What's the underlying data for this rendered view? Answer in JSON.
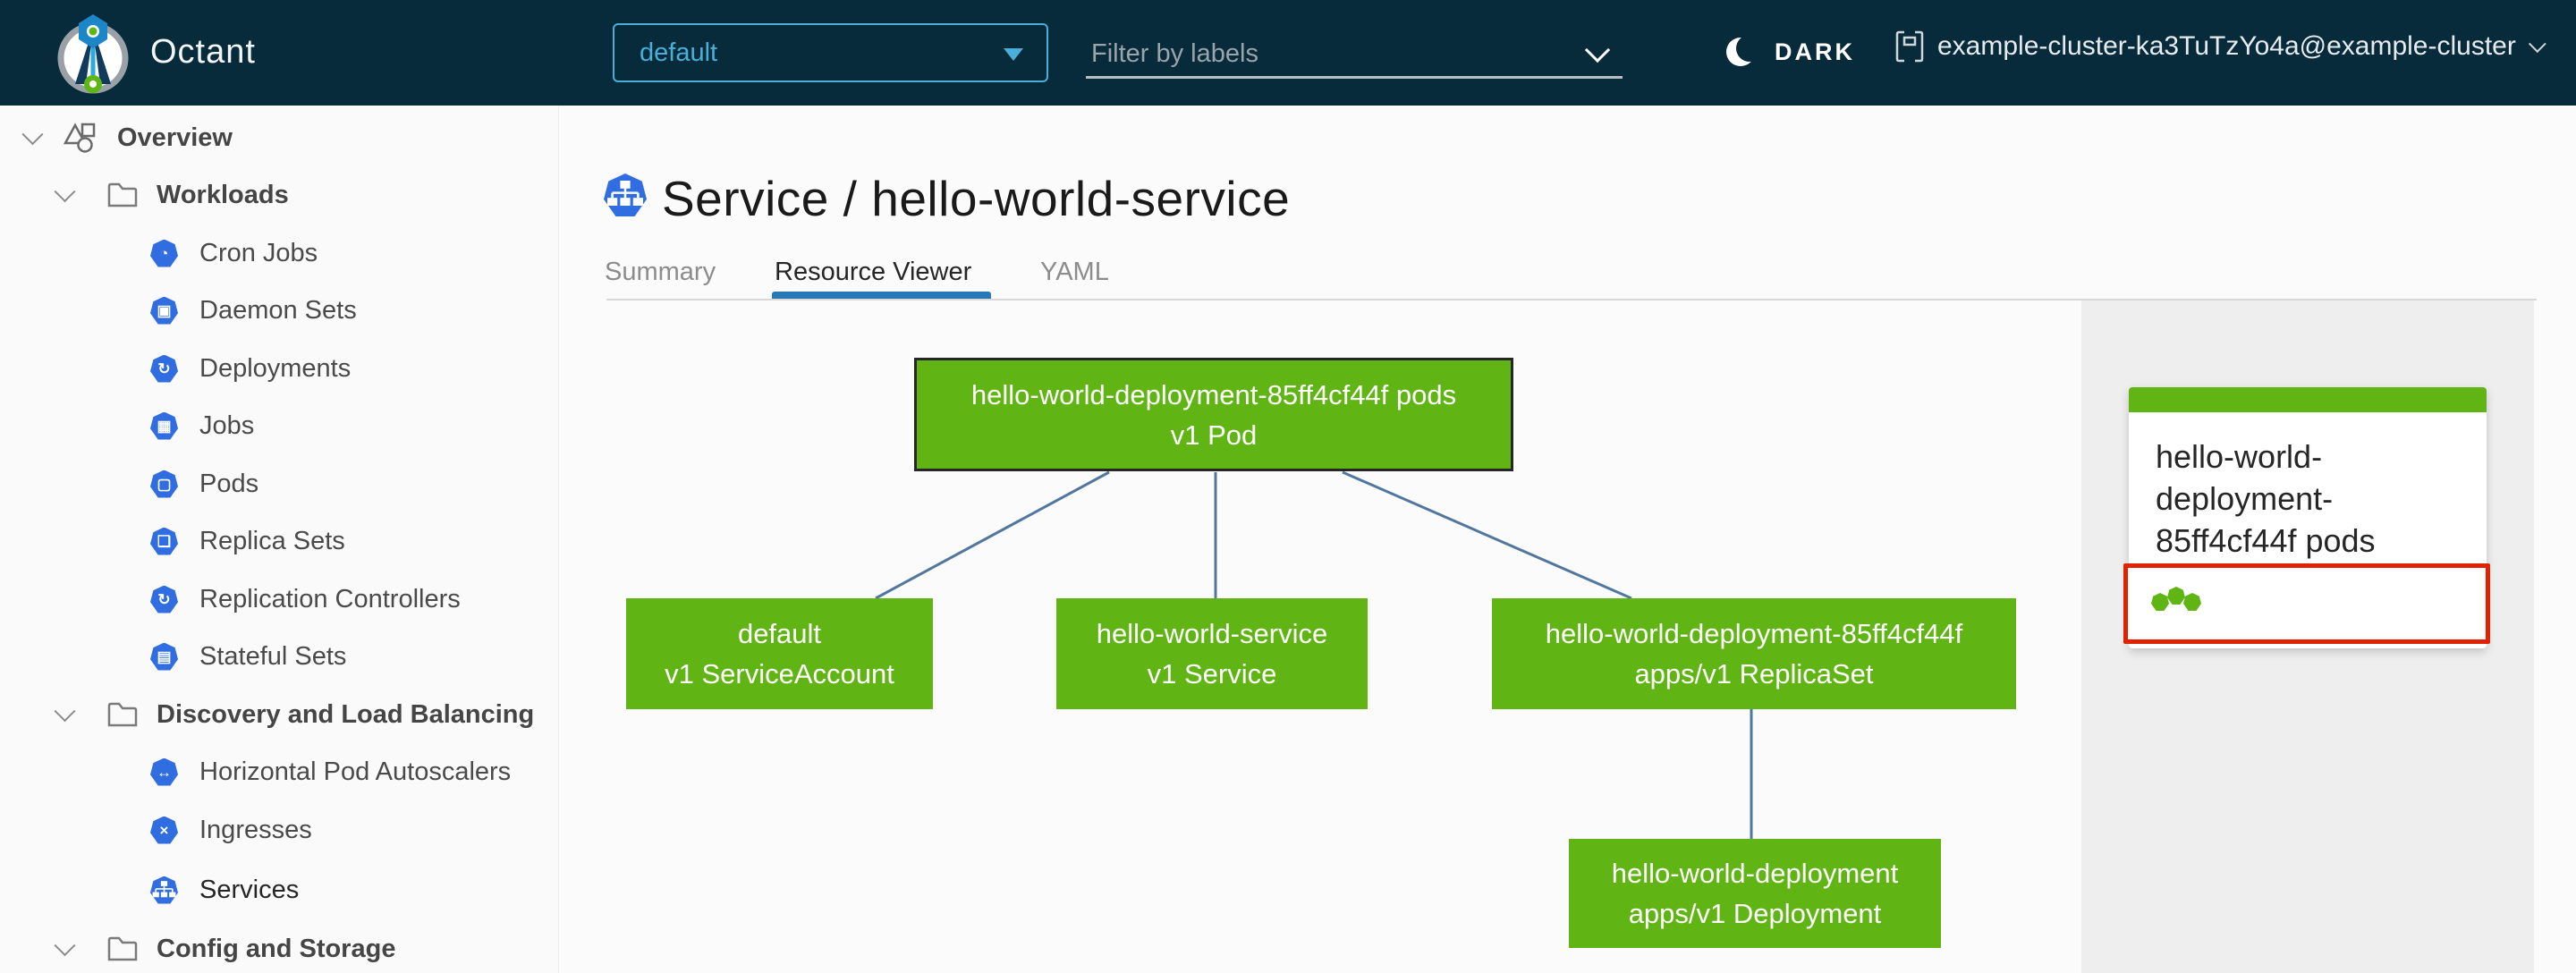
{
  "colors": {
    "header_bg": "#082b3c",
    "accent_blue": "#49afd9",
    "k8s_icon_blue": "#2f6de0",
    "node_green": "#60b515",
    "edge_blue": "#51779f",
    "tab_active_blue": "#2778b5",
    "selected_row_bg": "#d8e1e7",
    "alert_red": "#e12200",
    "panel_bg": "#eeeeee"
  },
  "header": {
    "app_title": "Octant",
    "namespace_select": {
      "value": "default"
    },
    "label_filter": {
      "placeholder": "Filter by labels"
    },
    "theme_toggle_label": "DARK",
    "context_selector_label": "example-cluster-ka3TuTzYo4a@example-cluster"
  },
  "sidebar": {
    "items": [
      {
        "label": "Overview",
        "level": 0,
        "icon": "objects-icon",
        "expanded": true
      },
      {
        "label": "Workloads",
        "level": 1,
        "icon": "folder-icon",
        "expanded": true
      },
      {
        "label": "Cron Jobs",
        "level": 2,
        "icon": "cronjob-icon",
        "glyph": "◔"
      },
      {
        "label": "Daemon Sets",
        "level": 2,
        "icon": "daemonset-icon",
        "glyph": "▣"
      },
      {
        "label": "Deployments",
        "level": 2,
        "icon": "deployment-icon",
        "glyph": "↻"
      },
      {
        "label": "Jobs",
        "level": 2,
        "icon": "job-icon",
        "glyph": "▦"
      },
      {
        "label": "Pods",
        "level": 2,
        "icon": "pod-icon",
        "glyph": "▢"
      },
      {
        "label": "Replica Sets",
        "level": 2,
        "icon": "replicaset-icon",
        "glyph": "❏"
      },
      {
        "label": "Replication Controllers",
        "level": 2,
        "icon": "replicationcontroller-icon",
        "glyph": "↻"
      },
      {
        "label": "Stateful Sets",
        "level": 2,
        "icon": "statefulset-icon",
        "glyph": "▤"
      },
      {
        "label": "Discovery and Load Balancing",
        "level": 1,
        "icon": "folder-icon",
        "expanded": true
      },
      {
        "label": "Horizontal Pod Autoscalers",
        "level": 2,
        "icon": "hpa-icon",
        "glyph": "↔"
      },
      {
        "label": "Ingresses",
        "level": 2,
        "icon": "ingress-icon",
        "glyph": "×"
      },
      {
        "label": "Services",
        "level": 2,
        "icon": "service-icon",
        "selected": true
      },
      {
        "label": "Config and Storage",
        "level": 1,
        "icon": "folder-icon",
        "expanded": true
      }
    ]
  },
  "main": {
    "page_title": "Service / hello-world-service",
    "tabs": [
      {
        "label": "Summary",
        "active": false
      },
      {
        "label": "Resource Viewer",
        "active": true
      },
      {
        "label": "YAML",
        "active": false
      }
    ]
  },
  "graph": {
    "nodes": [
      {
        "id": "pod",
        "line1": "hello-world-deployment-85ff4cf44f pods",
        "line2": "v1 Pod",
        "selected": true
      },
      {
        "id": "serviceaccount",
        "line1": "default",
        "line2": "v1 ServiceAccount",
        "selected": false
      },
      {
        "id": "service",
        "line1": "hello-world-service",
        "line2": "v1 Service",
        "selected": false
      },
      {
        "id": "replicaset",
        "line1": "hello-world-deployment-85ff4cf44f",
        "line2": "apps/v1 ReplicaSet",
        "selected": false
      },
      {
        "id": "deployment",
        "line1": "hello-world-deployment",
        "line2": "apps/v1 Deployment",
        "selected": false
      }
    ],
    "edges": [
      {
        "from": "pod",
        "to": "serviceaccount"
      },
      {
        "from": "pod",
        "to": "service"
      },
      {
        "from": "pod",
        "to": "replicaset"
      },
      {
        "from": "replicaset",
        "to": "deployment"
      }
    ]
  },
  "detail_panel": {
    "card_title": "hello-world-deployment-85ff4cf44f pods",
    "pod_status": {
      "count": 3,
      "status": "ok"
    }
  }
}
